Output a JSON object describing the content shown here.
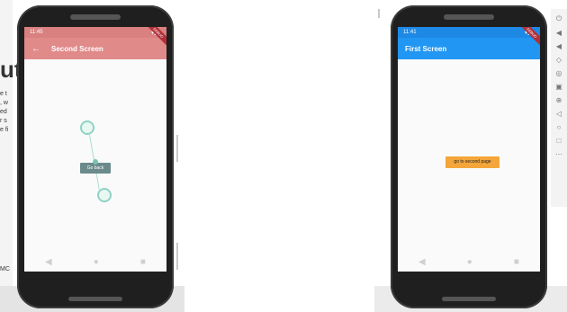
{
  "background": {
    "doc_fragment_big": "ut",
    "doc_fragment_lines": [
      "e t",
      ", w",
      "ed",
      "r s",
      "e fi"
    ],
    "doc_fragment_bottom": "MC"
  },
  "left_phone": {
    "status_time": "11:45",
    "status_icons": "▾◢▮",
    "appbar_title": "Second Screen",
    "back_icon": "arrow-back-icon",
    "button_label": "Go back",
    "appbar_color": "#e08a8a",
    "nav": [
      "◀",
      "●",
      "■"
    ]
  },
  "right_phone": {
    "status_time": "11:41",
    "status_icons": "▾◢▮",
    "appbar_title": "First Screen",
    "button_label": "go to second page",
    "appbar_color": "#2196f3",
    "button_color": "#f4a63a",
    "nav": [
      "◀",
      "●",
      "■"
    ]
  },
  "debug_banner": "DEBUG",
  "toolbar_icons": [
    "power-icon",
    "volume-up-icon",
    "volume-down-icon",
    "rotate-icon",
    "rotate-icon",
    "camera-icon",
    "zoom-icon",
    "back-icon",
    "home-icon",
    "overview-icon",
    "more-icon"
  ]
}
